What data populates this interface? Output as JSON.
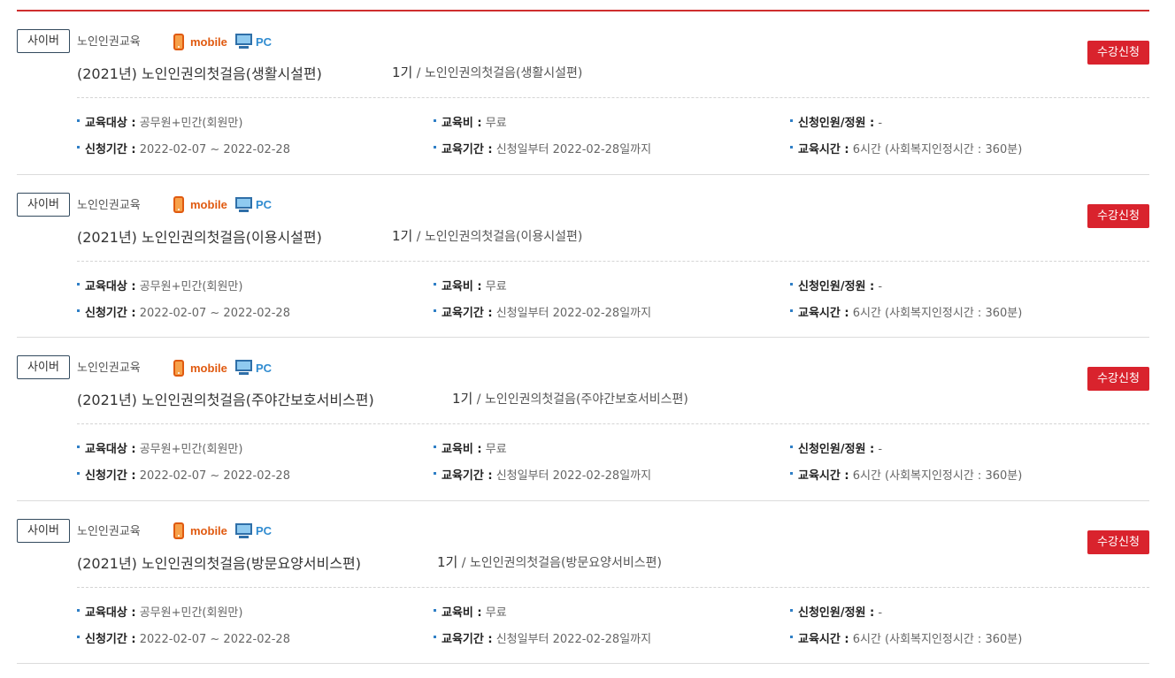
{
  "labels": {
    "target": "교육대상 :",
    "fee": "교육비 :",
    "quota": "신청인원/정원 :",
    "apply_period": "신청기간 :",
    "edu_period": "교육기간 :",
    "edu_time": "교육시간 :"
  },
  "courses": [
    {
      "type": "사이버",
      "category": "노인인권교육",
      "mobile": "mobile",
      "pc": "PC",
      "apply": "수강신청",
      "title": "(2021년) 노인인권의첫걸음(생활시설편)",
      "round_num": "1기",
      "round_rest": " / 노인인권의첫걸음(생활시설편)",
      "target": "공무원+민간(회원만)",
      "fee": "무료",
      "quota": "-",
      "apply_period": "2022-02-07 ~ 2022-02-28",
      "edu_period": "신청일부터 2022-02-28일까지",
      "edu_time": "6시간 (사회복지인정시간 : 360분)"
    },
    {
      "type": "사이버",
      "category": "노인인권교육",
      "mobile": "mobile",
      "pc": "PC",
      "apply": "수강신청",
      "title": "(2021년) 노인인권의첫걸음(이용시설편)",
      "round_num": "1기",
      "round_rest": " / 노인인권의첫걸음(이용시설편)",
      "target": "공무원+민간(회원만)",
      "fee": "무료",
      "quota": "-",
      "apply_period": "2022-02-07 ~ 2022-02-28",
      "edu_period": "신청일부터 2022-02-28일까지",
      "edu_time": "6시간 (사회복지인정시간 : 360분)"
    },
    {
      "type": "사이버",
      "category": "노인인권교육",
      "mobile": "mobile",
      "pc": "PC",
      "apply": "수강신청",
      "title": "(2021년) 노인인권의첫걸음(주야간보호서비스편)",
      "round_num": "1기",
      "round_rest": " / 노인인권의첫걸음(주야간보호서비스편)",
      "target": "공무원+민간(회원만)",
      "fee": "무료",
      "quota": "-",
      "apply_period": "2022-02-07 ~ 2022-02-28",
      "edu_period": "신청일부터 2022-02-28일까지",
      "edu_time": "6시간 (사회복지인정시간 : 360분)"
    },
    {
      "type": "사이버",
      "category": "노인인권교육",
      "mobile": "mobile",
      "pc": "PC",
      "apply": "수강신청",
      "title": "(2021년) 노인인권의첫걸음(방문요양서비스편)",
      "round_num": "1기",
      "round_rest": " / 노인인권의첫걸음(방문요양서비스편)",
      "target": "공무원+민간(회원만)",
      "fee": "무료",
      "quota": "-",
      "apply_period": "2022-02-07 ~ 2022-02-28",
      "edu_period": "신청일부터 2022-02-28일까지",
      "edu_time": "6시간 (사회복지인정시간 : 360분)"
    }
  ]
}
